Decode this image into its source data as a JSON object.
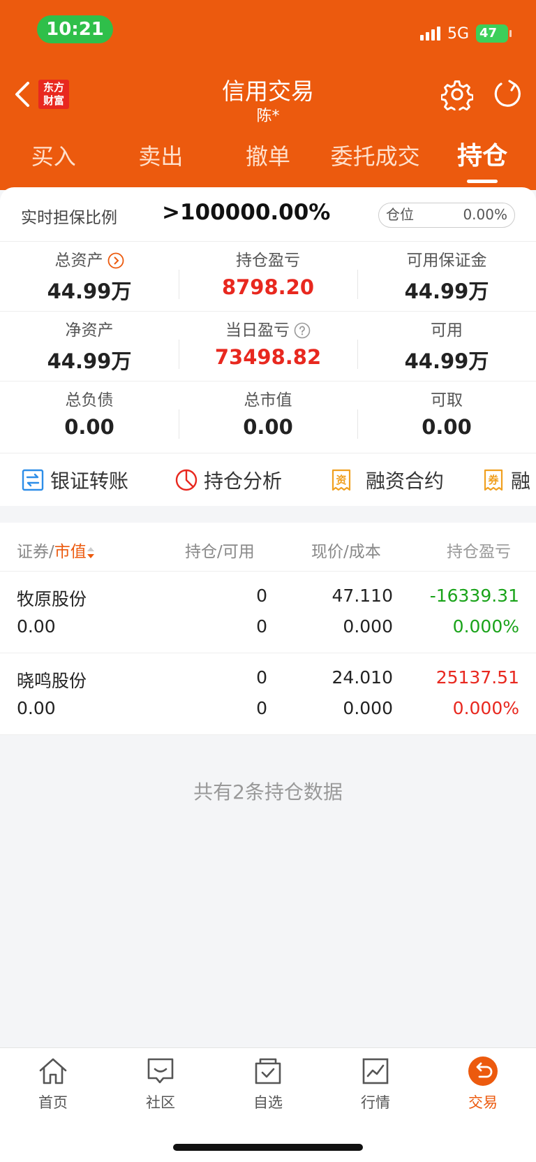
{
  "status_bar": {
    "time": "10:21",
    "network": "5G",
    "battery": "47"
  },
  "header": {
    "logo_text": "东方财富",
    "title": "信用交易",
    "subtitle": "陈*"
  },
  "tabs": [
    {
      "label": "买入",
      "active": false
    },
    {
      "label": "卖出",
      "active": false
    },
    {
      "label": "撤单",
      "active": false
    },
    {
      "label": "委托成交",
      "active": false
    },
    {
      "label": "持仓",
      "active": true
    }
  ],
  "ratio": {
    "label": "实时担保比例",
    "value": ">100000.00%",
    "position_label": "仓位",
    "position_value": "0.00%"
  },
  "metrics": [
    [
      {
        "label": "总资产",
        "value": "44.99万"
      },
      {
        "label": "持仓盈亏",
        "value": "8798.20"
      },
      {
        "label": "可用保证金",
        "value": "44.99万"
      }
    ],
    [
      {
        "label": "净资产",
        "value": "44.99万"
      },
      {
        "label": "当日盈亏",
        "value": "73498.82"
      },
      {
        "label": "可用",
        "value": "44.99万"
      }
    ],
    [
      {
        "label": "总负债",
        "value": "0.00"
      },
      {
        "label": "总市值",
        "value": "0.00"
      },
      {
        "label": "可取",
        "value": "0.00"
      }
    ]
  ],
  "shortcuts": [
    {
      "label": "银证转账",
      "icon": "transfer-icon"
    },
    {
      "label": "持仓分析",
      "icon": "pie-chart-icon"
    },
    {
      "label": "融资合约",
      "icon": "financing-contract-icon"
    },
    {
      "label": "融",
      "icon": "securities-lending-icon"
    }
  ],
  "table": {
    "col1_a": "证券",
    "col1_sep": "/",
    "col1_b": "市值",
    "col2": "持仓/可用",
    "col3": "现价/成本",
    "col4": "持仓盈亏",
    "rows": [
      {
        "name": "牧原股份",
        "market_value": "0.00",
        "position": "0",
        "available": "0",
        "price": "47.110",
        "cost": "0.000",
        "pnl": "-16339.31",
        "pnl_pct": "0.000%",
        "tone": "green"
      },
      {
        "name": "晓鸣股份",
        "market_value": "0.00",
        "position": "0",
        "available": "0",
        "price": "24.010",
        "cost": "0.000",
        "pnl": "25137.51",
        "pnl_pct": "0.000%",
        "tone": "red"
      }
    ],
    "footer": "共有2条持仓数据"
  },
  "bottom_nav": [
    {
      "label": "首页",
      "icon": "home-icon",
      "active": false
    },
    {
      "label": "社区",
      "icon": "community-icon",
      "active": false
    },
    {
      "label": "自选",
      "icon": "watchlist-icon",
      "active": false
    },
    {
      "label": "行情",
      "icon": "market-icon",
      "active": false
    },
    {
      "label": "交易",
      "icon": "trade-icon",
      "active": true
    }
  ],
  "colors": {
    "brand": "#ec5a0e",
    "up": "#e8281f",
    "down": "#1aa31a",
    "logo": "#e8281f"
  }
}
